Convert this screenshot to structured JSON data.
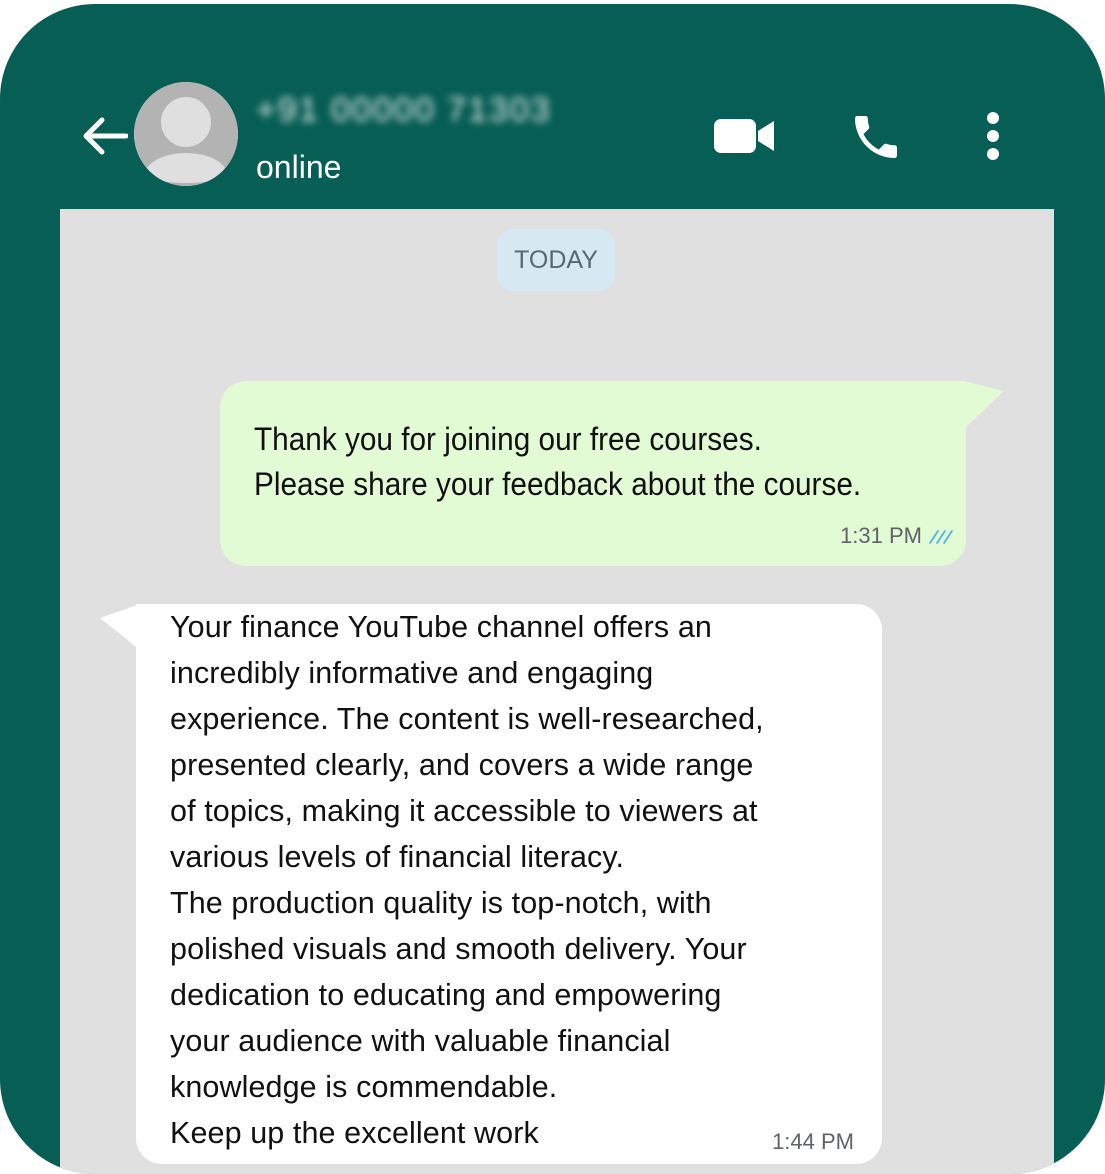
{
  "header": {
    "contact_name": "+91 00000 71303",
    "status": "online",
    "icons": {
      "back": "back-arrow-icon",
      "avatar": "default-user-avatar-icon",
      "video": "video-call-icon",
      "phone": "voice-call-icon",
      "menu": "more-options-icon"
    }
  },
  "chat": {
    "date_label": "TODAY",
    "messages": [
      {
        "direction": "outgoing",
        "lines": [
          "Thank you for joining our free courses.",
          "Please share your feedback about the course."
        ],
        "time": "1:31 PM",
        "status_icon": "double-check-read-icon"
      },
      {
        "direction": "incoming",
        "lines": [
          "Your finance YouTube channel offers an",
          "incredibly informative and engaging",
          "experience. The content is well-researched,",
          "presented clearly, and covers a wide range",
          "of topics, making it accessible to viewers at",
          "various levels of financial literacy.",
          "The production quality is top-notch, with",
          "polished visuals and smooth delivery. Your",
          "dedication to educating and empowering",
          "your audience with valuable financial",
          "knowledge is commendable.",
          "Keep up the excellent work"
        ],
        "time": "1:44 PM"
      }
    ]
  },
  "colors": {
    "header_bg": "#075E54",
    "chat_bg": "#E0E0E0",
    "outgoing_bubble": "#E2FBD4",
    "incoming_bubble": "#FFFFFF",
    "date_chip": "#D6E9F3",
    "read_ticks": "#4FB6EC"
  }
}
